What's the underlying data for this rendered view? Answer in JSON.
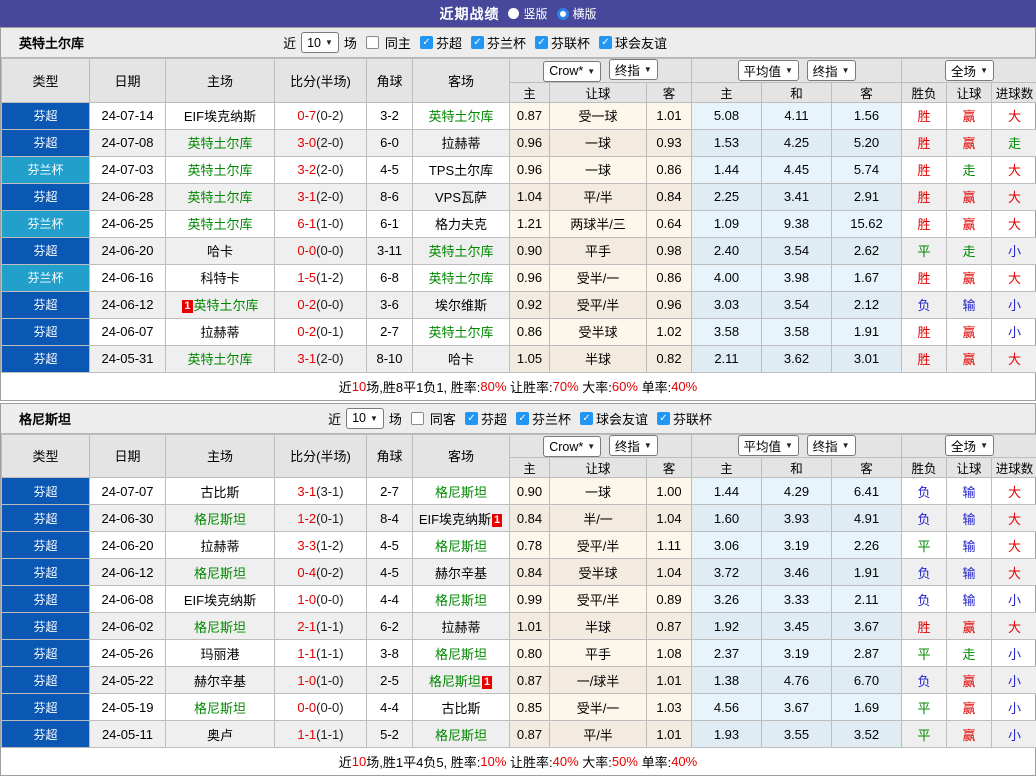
{
  "titlebar": {
    "title": "近期战绩",
    "radios": [
      {
        "label": "竖版",
        "selected": true
      },
      {
        "label": "横版",
        "selected": false
      }
    ]
  },
  "colors": {
    "accent_bar": "#47479b",
    "checkbox": "#2196f3",
    "badge": "#e60000",
    "score": "#e60000",
    "self_team": "#008800",
    "league": {
      "芬超": "#0a57b4",
      "芬兰杯": "#229fcb"
    },
    "result": {
      "胜": "#e60000",
      "赢": "#e60000",
      "大": "#e60000",
      "平": "#008800",
      "走": "#008800",
      "负": "#2222cc",
      "输": "#2222cc",
      "小": "#2222cc"
    }
  },
  "header": {
    "col_type": "类型",
    "col_date": "日期",
    "col_home": "主场",
    "col_score": "比分(半场)",
    "col_corner": "角球",
    "col_away": "客场",
    "sel_crow": "Crow*",
    "sel_final1": "终指",
    "sel_avg": "平均值",
    "sel_final2": "终指",
    "sel_full": "全场",
    "sub": [
      "主",
      "让球",
      "客",
      "主",
      "和",
      "客",
      "胜负",
      "让球",
      "进球数"
    ]
  },
  "tables": [
    {
      "team": "英特土尔库",
      "near_label": "近",
      "matches": "10",
      "games_label": "场",
      "same_label": "同主",
      "leagues": [
        "芬超",
        "芬兰杯",
        "芬联杯",
        "球会友谊"
      ],
      "rows": [
        {
          "league": "芬超",
          "date": "24-07-14",
          "home": {
            "name": "EIF埃克纳斯",
            "self": false
          },
          "score": "0-7",
          "half": "(0-2)",
          "corner": "3-2",
          "away": {
            "name": "英特土尔库",
            "self": true
          },
          "odds": [
            "0.87",
            "受一球",
            "1.01"
          ],
          "avg": [
            "5.08",
            "4.11",
            "1.56"
          ],
          "res": [
            "胜",
            "赢",
            "大"
          ]
        },
        {
          "league": "芬超",
          "date": "24-07-08",
          "home": {
            "name": "英特土尔库",
            "self": true
          },
          "score": "3-0",
          "half": "(2-0)",
          "corner": "6-0",
          "away": {
            "name": "拉赫蒂",
            "self": false
          },
          "odds": [
            "0.96",
            "一球",
            "0.93"
          ],
          "avg": [
            "1.53",
            "4.25",
            "5.20"
          ],
          "res": [
            "胜",
            "赢",
            "走"
          ]
        },
        {
          "league": "芬兰杯",
          "date": "24-07-03",
          "home": {
            "name": "英特土尔库",
            "self": true
          },
          "score": "3-2",
          "half": "(2-0)",
          "corner": "4-5",
          "away": {
            "name": "TPS土尔库",
            "self": false
          },
          "odds": [
            "0.96",
            "一球",
            "0.86"
          ],
          "avg": [
            "1.44",
            "4.45",
            "5.74"
          ],
          "res": [
            "胜",
            "走",
            "大"
          ]
        },
        {
          "league": "芬超",
          "date": "24-06-28",
          "home": {
            "name": "英特土尔库",
            "self": true
          },
          "score": "3-1",
          "half": "(2-0)",
          "corner": "8-6",
          "away": {
            "name": "VPS瓦萨",
            "self": false
          },
          "odds": [
            "1.04",
            "平/半",
            "0.84"
          ],
          "avg": [
            "2.25",
            "3.41",
            "2.91"
          ],
          "res": [
            "胜",
            "赢",
            "大"
          ]
        },
        {
          "league": "芬兰杯",
          "date": "24-06-25",
          "home": {
            "name": "英特土尔库",
            "self": true
          },
          "score": "6-1",
          "half": "(1-0)",
          "corner": "6-1",
          "away": {
            "name": "格力夫克",
            "self": false
          },
          "odds": [
            "1.21",
            "两球半/三",
            "0.64"
          ],
          "avg": [
            "1.09",
            "9.38",
            "15.62"
          ],
          "res": [
            "胜",
            "赢",
            "大"
          ]
        },
        {
          "league": "芬超",
          "date": "24-06-20",
          "home": {
            "name": "哈卡",
            "self": false
          },
          "score": "0-0",
          "half": "(0-0)",
          "corner": "3-11",
          "away": {
            "name": "英特土尔库",
            "self": true
          },
          "odds": [
            "0.90",
            "平手",
            "0.98"
          ],
          "avg": [
            "2.40",
            "3.54",
            "2.62"
          ],
          "res": [
            "平",
            "走",
            "小"
          ]
        },
        {
          "league": "芬兰杯",
          "date": "24-06-16",
          "home": {
            "name": "科特卡",
            "self": false
          },
          "score": "1-5",
          "half": "(1-2)",
          "corner": "6-8",
          "away": {
            "name": "英特土尔库",
            "self": true
          },
          "odds": [
            "0.96",
            "受半/一",
            "0.86"
          ],
          "avg": [
            "4.00",
            "3.98",
            "1.67"
          ],
          "res": [
            "胜",
            "赢",
            "大"
          ]
        },
        {
          "league": "芬超",
          "date": "24-06-12",
          "home": {
            "name": "英特土尔库",
            "self": true,
            "badge": "1",
            "badge_pos": "before"
          },
          "score": "0-2",
          "half": "(0-0)",
          "corner": "3-6",
          "away": {
            "name": "埃尔维斯",
            "self": false
          },
          "odds": [
            "0.92",
            "受平/半",
            "0.96"
          ],
          "avg": [
            "3.03",
            "3.54",
            "2.12"
          ],
          "res": [
            "负",
            "输",
            "小"
          ]
        },
        {
          "league": "芬超",
          "date": "24-06-07",
          "home": {
            "name": "拉赫蒂",
            "self": false
          },
          "score": "0-2",
          "half": "(0-1)",
          "corner": "2-7",
          "away": {
            "name": "英特土尔库",
            "self": true
          },
          "odds": [
            "0.86",
            "受半球",
            "1.02"
          ],
          "avg": [
            "3.58",
            "3.58",
            "1.91"
          ],
          "res": [
            "胜",
            "赢",
            "小"
          ]
        },
        {
          "league": "芬超",
          "date": "24-05-31",
          "home": {
            "name": "英特土尔库",
            "self": true
          },
          "score": "3-1",
          "half": "(2-0)",
          "corner": "8-10",
          "away": {
            "name": "哈卡",
            "self": false
          },
          "odds": [
            "1.05",
            "半球",
            "0.82"
          ],
          "avg": [
            "2.11",
            "3.62",
            "3.01"
          ],
          "res": [
            "胜",
            "赢",
            "大"
          ]
        }
      ],
      "footer": [
        {
          "text": "近"
        },
        {
          "text": "10",
          "red": true
        },
        {
          "text": "场,胜8平1负1, 胜率:"
        },
        {
          "text": "80%",
          "red": true
        },
        {
          "text": " 让胜率:"
        },
        {
          "text": "70%",
          "red": true
        },
        {
          "text": " 大率:"
        },
        {
          "text": "60%",
          "red": true
        },
        {
          "text": " 单率:"
        },
        {
          "text": "40%",
          "red": true
        }
      ]
    },
    {
      "team": "格尼斯坦",
      "near_label": "近",
      "matches": "10",
      "games_label": "场",
      "same_label": "同客",
      "leagues": [
        "芬超",
        "芬兰杯",
        "球会友谊",
        "芬联杯"
      ],
      "rows": [
        {
          "league": "芬超",
          "date": "24-07-07",
          "home": {
            "name": "古比斯",
            "self": false
          },
          "score": "3-1",
          "half": "(3-1)",
          "corner": "2-7",
          "away": {
            "name": "格尼斯坦",
            "self": true
          },
          "odds": [
            "0.90",
            "一球",
            "1.00"
          ],
          "avg": [
            "1.44",
            "4.29",
            "6.41"
          ],
          "res": [
            "负",
            "输",
            "大"
          ]
        },
        {
          "league": "芬超",
          "date": "24-06-30",
          "home": {
            "name": "格尼斯坦",
            "self": true
          },
          "score": "1-2",
          "half": "(0-1)",
          "corner": "8-4",
          "away": {
            "name": "EIF埃克纳斯",
            "self": false,
            "badge": "1",
            "badge_pos": "after"
          },
          "odds": [
            "0.84",
            "半/一",
            "1.04"
          ],
          "avg": [
            "1.60",
            "3.93",
            "4.91"
          ],
          "res": [
            "负",
            "输",
            "大"
          ]
        },
        {
          "league": "芬超",
          "date": "24-06-20",
          "home": {
            "name": "拉赫蒂",
            "self": false
          },
          "score": "3-3",
          "half": "(1-2)",
          "corner": "4-5",
          "away": {
            "name": "格尼斯坦",
            "self": true
          },
          "odds": [
            "0.78",
            "受平/半",
            "1.11"
          ],
          "avg": [
            "3.06",
            "3.19",
            "2.26"
          ],
          "res": [
            "平",
            "输",
            "大"
          ]
        },
        {
          "league": "芬超",
          "date": "24-06-12",
          "home": {
            "name": "格尼斯坦",
            "self": true
          },
          "score": "0-4",
          "half": "(0-2)",
          "corner": "4-5",
          "away": {
            "name": "赫尔辛基",
            "self": false
          },
          "odds": [
            "0.84",
            "受半球",
            "1.04"
          ],
          "avg": [
            "3.72",
            "3.46",
            "1.91"
          ],
          "res": [
            "负",
            "输",
            "大"
          ]
        },
        {
          "league": "芬超",
          "date": "24-06-08",
          "home": {
            "name": "EIF埃克纳斯",
            "self": false
          },
          "score": "1-0",
          "half": "(0-0)",
          "corner": "4-4",
          "away": {
            "name": "格尼斯坦",
            "self": true
          },
          "odds": [
            "0.99",
            "受平/半",
            "0.89"
          ],
          "avg": [
            "3.26",
            "3.33",
            "2.11"
          ],
          "res": [
            "负",
            "输",
            "小"
          ]
        },
        {
          "league": "芬超",
          "date": "24-06-02",
          "home": {
            "name": "格尼斯坦",
            "self": true
          },
          "score": "2-1",
          "half": "(1-1)",
          "corner": "6-2",
          "away": {
            "name": "拉赫蒂",
            "self": false
          },
          "odds": [
            "1.01",
            "半球",
            "0.87"
          ],
          "avg": [
            "1.92",
            "3.45",
            "3.67"
          ],
          "res": [
            "胜",
            "赢",
            "大"
          ]
        },
        {
          "league": "芬超",
          "date": "24-05-26",
          "home": {
            "name": "玛丽港",
            "self": false
          },
          "score": "1-1",
          "half": "(1-1)",
          "corner": "3-8",
          "away": {
            "name": "格尼斯坦",
            "self": true
          },
          "odds": [
            "0.80",
            "平手",
            "1.08"
          ],
          "avg": [
            "2.37",
            "3.19",
            "2.87"
          ],
          "res": [
            "平",
            "走",
            "小"
          ]
        },
        {
          "league": "芬超",
          "date": "24-05-22",
          "home": {
            "name": "赫尔辛基",
            "self": false
          },
          "score": "1-0",
          "half": "(1-0)",
          "corner": "2-5",
          "away": {
            "name": "格尼斯坦",
            "self": true,
            "badge": "1",
            "badge_pos": "after"
          },
          "odds": [
            "0.87",
            "一/球半",
            "1.01"
          ],
          "avg": [
            "1.38",
            "4.76",
            "6.70"
          ],
          "res": [
            "负",
            "赢",
            "小"
          ]
        },
        {
          "league": "芬超",
          "date": "24-05-19",
          "home": {
            "name": "格尼斯坦",
            "self": true
          },
          "score": "0-0",
          "half": "(0-0)",
          "corner": "4-4",
          "away": {
            "name": "古比斯",
            "self": false
          },
          "odds": [
            "0.85",
            "受半/一",
            "1.03"
          ],
          "avg": [
            "4.56",
            "3.67",
            "1.69"
          ],
          "res": [
            "平",
            "赢",
            "小"
          ]
        },
        {
          "league": "芬超",
          "date": "24-05-11",
          "home": {
            "name": "奥卢",
            "self": false
          },
          "score": "1-1",
          "half": "(1-1)",
          "corner": "5-2",
          "away": {
            "name": "格尼斯坦",
            "self": true
          },
          "odds": [
            "0.87",
            "平/半",
            "1.01"
          ],
          "avg": [
            "1.93",
            "3.55",
            "3.52"
          ],
          "res": [
            "平",
            "赢",
            "小"
          ]
        }
      ],
      "footer": [
        {
          "text": "近"
        },
        {
          "text": "10",
          "red": true
        },
        {
          "text": "场,胜1平4负5, 胜率:"
        },
        {
          "text": "10%",
          "red": true
        },
        {
          "text": " 让胜率:"
        },
        {
          "text": "40%",
          "red": true
        },
        {
          "text": " 大率:"
        },
        {
          "text": "50%",
          "red": true
        },
        {
          "text": " 单率:"
        },
        {
          "text": "40%",
          "red": true
        }
      ]
    }
  ]
}
